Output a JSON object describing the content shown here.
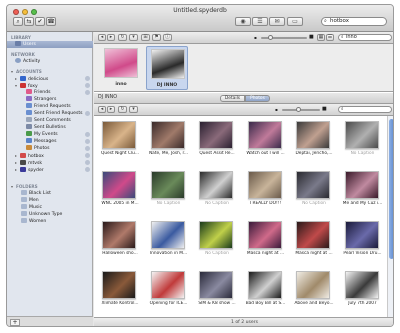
{
  "window": {
    "title": "Untitled.spyderdb"
  },
  "toolbar": {
    "buttons": [
      "⌕",
      "⇆",
      "✔",
      "☎",
      "◉",
      "☰",
      "✉",
      "▭"
    ],
    "search_value": "hotbox"
  },
  "sidebar": {
    "library_label": "LIBRARY",
    "users_label": "Users",
    "network_label": "NETWORK",
    "activity_label": "Activity",
    "accounts_label": "ACCOUNTS",
    "accounts": [
      {
        "label": "delicious",
        "indent": 1,
        "tri": "▸",
        "color": "#3366cc",
        "badge": true
      },
      {
        "label": "foxy",
        "indent": 1,
        "tri": "▾",
        "color": "#cc3333",
        "badge": true
      },
      {
        "label": "Friends",
        "indent": 2,
        "tri": "",
        "color": "#e05a8a",
        "badge": true
      },
      {
        "label": "Strangers",
        "indent": 2,
        "tri": "",
        "color": "#8a6cc4",
        "badge": false
      },
      {
        "label": "Friend Requests",
        "indent": 2,
        "tri": "",
        "color": "#6a8fd0",
        "badge": false
      },
      {
        "label": "Sent Friend Requests",
        "indent": 2,
        "tri": "",
        "color": "#6a8fd0",
        "badge": true
      },
      {
        "label": "Sent Comments",
        "indent": 2,
        "tri": "",
        "color": "#9aa6ba",
        "badge": false
      },
      {
        "label": "Sent Bulletins",
        "indent": 2,
        "tri": "",
        "color": "#7c8aa6",
        "badge": false
      },
      {
        "label": "My Events",
        "indent": 2,
        "tri": "",
        "color": "#4a9a4a",
        "badge": true
      },
      {
        "label": "Messages",
        "indent": 2,
        "tri": "",
        "color": "#5a83c8",
        "badge": true
      },
      {
        "label": "Photos",
        "indent": 2,
        "tri": "",
        "color": "#c88a3a",
        "badge": true
      },
      {
        "label": "hotbox",
        "indent": 1,
        "tri": "▸",
        "color": "#d24a4a",
        "badge": true
      },
      {
        "label": "mtvsk",
        "indent": 1,
        "tri": "▸",
        "color": "#4a4a4a",
        "badge": true
      },
      {
        "label": "spyder",
        "indent": 1,
        "tri": "▸",
        "color": "#3a3a9a",
        "badge": true
      }
    ],
    "folders_label": "FOLDERS",
    "folders": [
      "Black List",
      "Men",
      "Music",
      "Unknown Type",
      "Women"
    ]
  },
  "users_panel": {
    "search_value": "inno",
    "users": [
      {
        "label": "inno",
        "colors": [
          "#d04a8a",
          "#f0c0d8"
        ],
        "selected": false
      },
      {
        "label": "DJ INNO",
        "colors": [
          "#2a2a2a",
          "#f0f0f0"
        ],
        "selected": true
      }
    ]
  },
  "detail_bar": {
    "title": "DJ INNO",
    "tabs": [
      "Details",
      "Photos"
    ],
    "active_tab": 1
  },
  "photos": [
    {
      "label": "Quest Night Clu...",
      "c1": "#7a5a3a",
      "c2": "#d9b48a",
      "caption": true
    },
    {
      "label": "Nate, Me, Josh, r...",
      "c1": "#3a2a2a",
      "c2": "#a07a6a",
      "caption": true
    },
    {
      "label": "Quest Assit Re...",
      "c1": "#2a2030",
      "c2": "#8a6a7a",
      "caption": true
    },
    {
      "label": "Watch out I will ...",
      "c1": "#3a2a4a",
      "c2": "#c07a9a",
      "caption": true
    },
    {
      "label": "Deptai, Jericho,...",
      "c1": "#3a3a3a",
      "c2": "#c0a090",
      "caption": true
    },
    {
      "label": "No Caption",
      "c1": "#4a4a4a",
      "c2": "#b0b0b0",
      "caption": false
    },
    {
      "label": "WNC 2005 in M...",
      "c1": "#3a4a7a",
      "c2": "#d04a8a",
      "caption": true
    },
    {
      "label": "No Caption",
      "c1": "#2a3a2a",
      "c2": "#6a8a5a",
      "caption": false
    },
    {
      "label": "No Caption",
      "c1": "#2a2a2a",
      "c2": "#d0d0d0",
      "caption": false
    },
    {
      "label": "I REALLY DO!!!",
      "c1": "#6a5a4a",
      "c2": "#c8b49a",
      "caption": true
    },
    {
      "label": "No Caption",
      "c1": "#2a2a30",
      "c2": "#7a7a8a",
      "caption": false
    },
    {
      "label": "Me and My Cuz i...",
      "c1": "#3a1a2a",
      "c2": "#c08aa0",
      "caption": true
    },
    {
      "label": "Halloween sho...",
      "c1": "#2a1a1a",
      "c2": "#b07a6a",
      "caption": true
    },
    {
      "label": "Innovation in M...",
      "c1": "#f0f0f0",
      "c2": "#3a5aa0",
      "caption": true
    },
    {
      "label": "No Caption",
      "c1": "#1a3a1a",
      "c2": "#c0d04a",
      "caption": false
    },
    {
      "label": "Masca night at ...",
      "c1": "#3a1a3a",
      "c2": "#d06a8a",
      "caption": true
    },
    {
      "label": "Masca night at ...",
      "c1": "#2a1a1a",
      "c2": "#c04a4a",
      "caption": true
    },
    {
      "label": "Pearl Vision Dru...",
      "c1": "#1a1a3a",
      "c2": "#6a6aaa",
      "caption": true
    },
    {
      "label": "Xlimate Kontrol...",
      "c1": "#1a1a1a",
      "c2": "#8a5a3a",
      "caption": true
    },
    {
      "label": "Opening for ICE...",
      "c1": "#f4f4f4",
      "c2": "#c03a3a",
      "caption": true
    },
    {
      "label": "SIM & K8 show ...",
      "c1": "#2a2a3a",
      "c2": "#8a8aa0",
      "caption": true
    },
    {
      "label": "Bad Boy Bill at S...",
      "c1": "#1a1a1a",
      "c2": "#d0d0d0",
      "caption": true
    },
    {
      "label": "Above and Beyo...",
      "c1": "#f0ece4",
      "c2": "#a08a6a",
      "caption": true
    },
    {
      "label": "July 7th 2007",
      "c1": "#f4f4f4",
      "c2": "#3a3a3a",
      "caption": true
    }
  ],
  "status": {
    "text": "1 of 2 users"
  },
  "colors": {
    "selection": "#8d9fc1",
    "scroll_thumb": "#5f8ad0"
  }
}
